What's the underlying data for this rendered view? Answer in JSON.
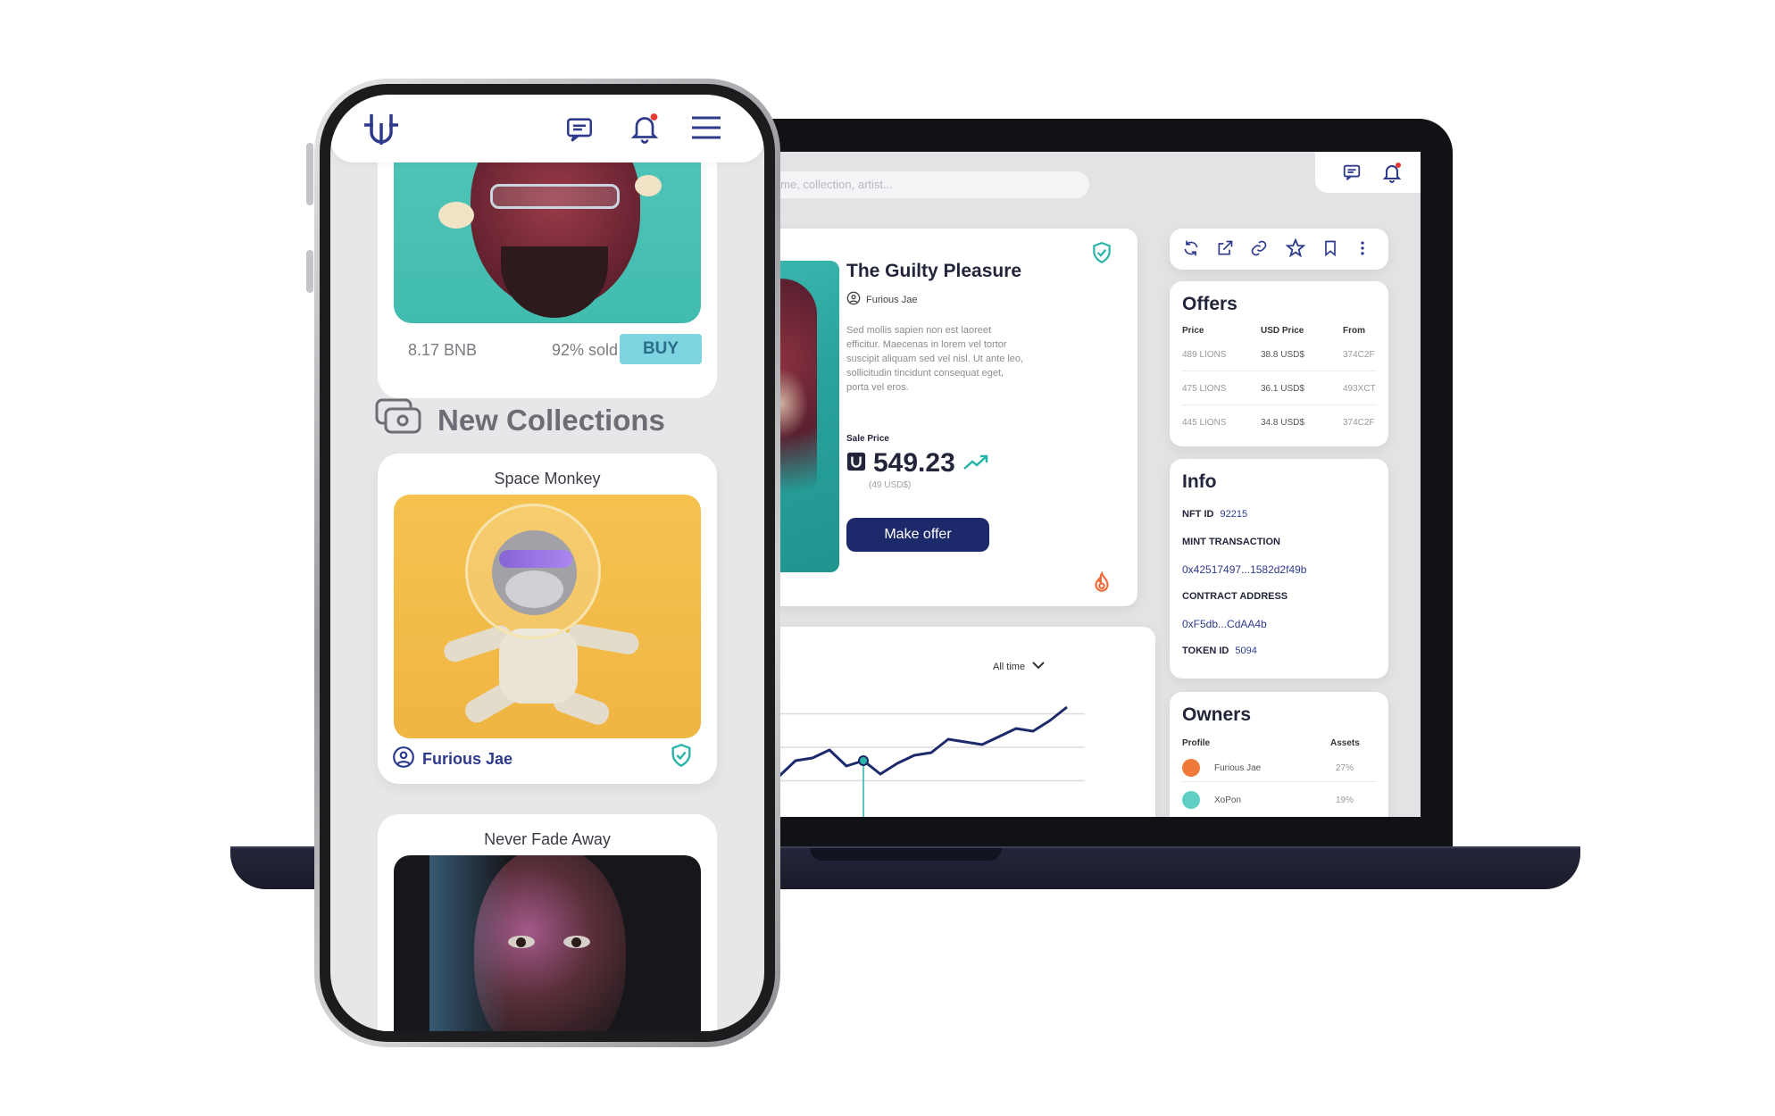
{
  "laptop": {
    "search": {
      "placeholder": "ch by name, collection, artist..."
    },
    "nft": {
      "title": "The Guilty Pleasure",
      "owner": "Furious Jae",
      "description": "Sed mollis sapien non est laoreet efficitur. Maecenas in lorem vel tortor suscipit aliquam sed vel nisl. Ut ante leo, sollicitudin tincidunt consequat eget, porta vel eros.",
      "sale_label": "Sale Price",
      "price": "549.23",
      "usd": "(49 USD$)",
      "offer_button": "Make offer"
    },
    "offers": {
      "title": "Offers",
      "headers": [
        "Price",
        "USD Price",
        "From"
      ],
      "rows": [
        [
          "489 LIONS",
          "38.8 USD$",
          "374C2F"
        ],
        [
          "475 LIONS",
          "36.1 USD$",
          "493XCT"
        ],
        [
          "445 LIONS",
          "34.8 USD$",
          "374C2F"
        ]
      ]
    },
    "info": {
      "title": "Info",
      "nft_id_label": "NFT ID",
      "nft_id": "92215",
      "mint_label": "MINT TRANSACTION",
      "mint_value": "0x42517497...1582d2f49b",
      "contract_label": "CONTRACT ADDRESS",
      "contract_value": "0xF5db...CdAA4b",
      "token_label": "TOKEN ID",
      "token_value": "5094"
    },
    "owners": {
      "title": "Owners",
      "headers": [
        "Profile",
        "Assets"
      ],
      "rows": [
        {
          "name": "Furious Jae",
          "assets": "27%",
          "color": "#f07a3a"
        },
        {
          "name": "XoPon",
          "assets": "19%",
          "color": "#5fcfc4"
        }
      ]
    },
    "chart": {
      "range_label": "All time"
    }
  },
  "phone": {
    "card1": {
      "price": "8.17 BNB",
      "sold": "92% sold",
      "buy": "BUY"
    },
    "section_title": "New Collections",
    "card2": {
      "title": "Space Monkey",
      "author": "Furious Jae"
    },
    "card3": {
      "title": "Never Fade Away"
    }
  },
  "colors": {
    "brand_navy": "#1c2a6b",
    "accent_teal": "#27b3a8",
    "buy_button": "#7dd3df",
    "notification": "#e53935"
  },
  "chart_data": {
    "type": "line",
    "x": [
      0,
      1,
      2,
      3,
      4,
      5,
      6,
      7,
      8,
      9,
      10,
      11,
      12,
      13,
      14,
      15,
      16,
      17,
      18,
      19,
      20
    ],
    "values": [
      12,
      20,
      38,
      28,
      40,
      42,
      48,
      36,
      40,
      30,
      38,
      44,
      46,
      56,
      54,
      52,
      58,
      64,
      62,
      70,
      80
    ],
    "ylim": [
      0,
      100
    ],
    "highlight_index": 8,
    "grid": true
  }
}
